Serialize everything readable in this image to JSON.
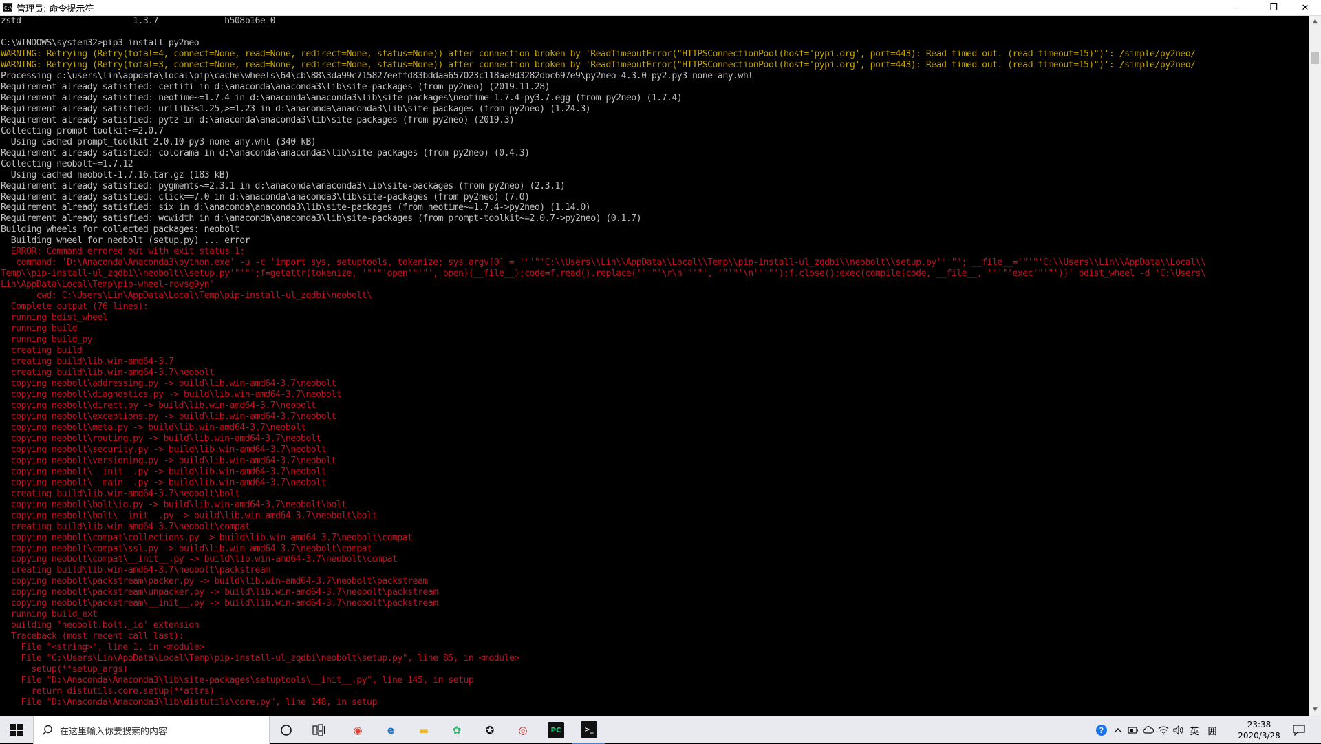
{
  "window": {
    "title": "管理员: 命令提示符",
    "controls": {
      "minimize": "—",
      "restore": "❐",
      "close": "✕"
    }
  },
  "console": {
    "lines": [
      {
        "t": "zstd                      1.3.7             h508b16e_0",
        "c": "white"
      },
      {
        "t": "",
        "c": "white"
      },
      {
        "t": "C:\\WINDOWS\\system32>pip3 install py2neo",
        "c": "white"
      },
      {
        "t": "WARNING: Retrying (Retry(total=4, connect=None, read=None, redirect=None, status=None)) after connection broken by 'ReadTimeoutError(\"HTTPSConnectionPool(host='pypi.org', port=443): Read timed out. (read timeout=15)\")': /simple/py2neo/",
        "c": "yellow"
      },
      {
        "t": "WARNING: Retrying (Retry(total=3, connect=None, read=None, redirect=None, status=None)) after connection broken by 'ReadTimeoutError(\"HTTPSConnectionPool(host='pypi.org', port=443): Read timed out. (read timeout=15)\")': /simple/py2neo/",
        "c": "yellow"
      },
      {
        "t": "Processing c:\\users\\lin\\appdata\\local\\pip\\cache\\wheels\\64\\cb\\88\\3da99c715827eeffd83bddaa657023c118aa9d3282dbc697e9\\py2neo-4.3.0-py2.py3-none-any.whl",
        "c": "white"
      },
      {
        "t": "Requirement already satisfied: certifi in d:\\anaconda\\anaconda3\\lib\\site-packages (from py2neo) (2019.11.28)",
        "c": "white"
      },
      {
        "t": "Requirement already satisfied: neotime~=1.7.4 in d:\\anaconda\\anaconda3\\lib\\site-packages\\neotime-1.7.4-py3.7.egg (from py2neo) (1.7.4)",
        "c": "white"
      },
      {
        "t": "Requirement already satisfied: urllib3<1.25,>=1.23 in d:\\anaconda\\anaconda3\\lib\\site-packages (from py2neo) (1.24.3)",
        "c": "white"
      },
      {
        "t": "Requirement already satisfied: pytz in d:\\anaconda\\anaconda3\\lib\\site-packages (from py2neo) (2019.3)",
        "c": "white"
      },
      {
        "t": "Collecting prompt-toolkit~=2.0.7",
        "c": "white"
      },
      {
        "t": "  Using cached prompt_toolkit-2.0.10-py3-none-any.whl (340 kB)",
        "c": "white"
      },
      {
        "t": "Requirement already satisfied: colorama in d:\\anaconda\\anaconda3\\lib\\site-packages (from py2neo) (0.4.3)",
        "c": "white"
      },
      {
        "t": "Collecting neobolt~=1.7.12",
        "c": "white"
      },
      {
        "t": "  Using cached neobolt-1.7.16.tar.gz (183 kB)",
        "c": "white"
      },
      {
        "t": "Requirement already satisfied: pygments~=2.3.1 in d:\\anaconda\\anaconda3\\lib\\site-packages (from py2neo) (2.3.1)",
        "c": "white"
      },
      {
        "t": "Requirement already satisfied: click==7.0 in d:\\anaconda\\anaconda3\\lib\\site-packages (from py2neo) (7.0)",
        "c": "white"
      },
      {
        "t": "Requirement already satisfied: six in d:\\anaconda\\anaconda3\\lib\\site-packages (from neotime~=1.7.4->py2neo) (1.14.0)",
        "c": "white"
      },
      {
        "t": "Requirement already satisfied: wcwidth in d:\\anaconda\\anaconda3\\lib\\site-packages (from prompt-toolkit~=2.0.7->py2neo) (0.1.7)",
        "c": "white"
      },
      {
        "t": "Building wheels for collected packages: neobolt",
        "c": "white"
      },
      {
        "t": "  Building wheel for neobolt (setup.py) ... error",
        "c": "white"
      },
      {
        "t": "  ERROR: Command errored out with exit status 1:",
        "c": "red"
      },
      {
        "t": "   command: 'D:\\Anaconda\\Anaconda3\\python.exe' -u -c 'import sys, setuptools, tokenize; sys.argv[0] = '\"'\"'C:\\\\Users\\\\Lin\\\\AppData\\\\Local\\\\Temp\\\\pip-install-ul_zqdbi\\\\neobolt\\\\setup.py'\"'\"'; __file__='\"'\"'C:\\\\Users\\\\Lin\\\\AppData\\\\Local\\\\",
        "c": "red"
      },
      {
        "t": "Temp\\\\pip-install-ul_zqdbi\\\\neobolt\\\\setup.py'\"'\"';f=getattr(tokenize, '\"'\"'open'\"'\"', open)(__file__);code=f.read().replace('\"'\"'\\r\\n'\"'\"', '\"'\"'\\n'\"'\"');f.close();exec(compile(code, __file__, '\"'\"'exec'\"'\"'))' bdist_wheel -d 'C:\\Users\\",
        "c": "red"
      },
      {
        "t": "Lin\\AppData\\Local\\Temp\\pip-wheel-rovsg9yn'",
        "c": "red"
      },
      {
        "t": "       cwd: C:\\Users\\Lin\\AppData\\Local\\Temp\\pip-install-ul_zqdbi\\neobolt\\",
        "c": "red"
      },
      {
        "t": "  Complete output (76 lines):",
        "c": "red"
      },
      {
        "t": "  running bdist_wheel",
        "c": "red"
      },
      {
        "t": "  running build",
        "c": "red"
      },
      {
        "t": "  running build_py",
        "c": "red"
      },
      {
        "t": "  creating build",
        "c": "red"
      },
      {
        "t": "  creating build\\lib.win-amd64-3.7",
        "c": "red"
      },
      {
        "t": "  creating build\\lib.win-amd64-3.7\\neobolt",
        "c": "red"
      },
      {
        "t": "  copying neobolt\\addressing.py -> build\\lib.win-amd64-3.7\\neobolt",
        "c": "red"
      },
      {
        "t": "  copying neobolt\\diagnostics.py -> build\\lib.win-amd64-3.7\\neobolt",
        "c": "red"
      },
      {
        "t": "  copying neobolt\\direct.py -> build\\lib.win-amd64-3.7\\neobolt",
        "c": "red"
      },
      {
        "t": "  copying neobolt\\exceptions.py -> build\\lib.win-amd64-3.7\\neobolt",
        "c": "red"
      },
      {
        "t": "  copying neobolt\\meta.py -> build\\lib.win-amd64-3.7\\neobolt",
        "c": "red"
      },
      {
        "t": "  copying neobolt\\routing.py -> build\\lib.win-amd64-3.7\\neobolt",
        "c": "red"
      },
      {
        "t": "  copying neobolt\\security.py -> build\\lib.win-amd64-3.7\\neobolt",
        "c": "red"
      },
      {
        "t": "  copying neobolt\\versioning.py -> build\\lib.win-amd64-3.7\\neobolt",
        "c": "red"
      },
      {
        "t": "  copying neobolt\\__init__.py -> build\\lib.win-amd64-3.7\\neobolt",
        "c": "red"
      },
      {
        "t": "  copying neobolt\\__main__.py -> build\\lib.win-amd64-3.7\\neobolt",
        "c": "red"
      },
      {
        "t": "  creating build\\lib.win-amd64-3.7\\neobolt\\bolt",
        "c": "red"
      },
      {
        "t": "  copying neobolt\\bolt\\io.py -> build\\lib.win-amd64-3.7\\neobolt\\bolt",
        "c": "red"
      },
      {
        "t": "  copying neobolt\\bolt\\__init__.py -> build\\lib.win-amd64-3.7\\neobolt\\bolt",
        "c": "red"
      },
      {
        "t": "  creating build\\lib.win-amd64-3.7\\neobolt\\compat",
        "c": "red"
      },
      {
        "t": "  copying neobolt\\compat\\collections.py -> build\\lib.win-amd64-3.7\\neobolt\\compat",
        "c": "red"
      },
      {
        "t": "  copying neobolt\\compat\\ssl.py -> build\\lib.win-amd64-3.7\\neobolt\\compat",
        "c": "red"
      },
      {
        "t": "  copying neobolt\\compat\\__init__.py -> build\\lib.win-amd64-3.7\\neobolt\\compat",
        "c": "red"
      },
      {
        "t": "  creating build\\lib.win-amd64-3.7\\neobolt\\packstream",
        "c": "red"
      },
      {
        "t": "  copying neobolt\\packstream\\packer.py -> build\\lib.win-amd64-3.7\\neobolt\\packstream",
        "c": "red"
      },
      {
        "t": "  copying neobolt\\packstream\\unpacker.py -> build\\lib.win-amd64-3.7\\neobolt\\packstream",
        "c": "red"
      },
      {
        "t": "  copying neobolt\\packstream\\__init__.py -> build\\lib.win-amd64-3.7\\neobolt\\packstream",
        "c": "red"
      },
      {
        "t": "  running build_ext",
        "c": "red"
      },
      {
        "t": "  building 'neobolt.bolt._io' extension",
        "c": "red"
      },
      {
        "t": "  Traceback (most recent call last):",
        "c": "red"
      },
      {
        "t": "    File \"<string>\", line 1, in <module>",
        "c": "red"
      },
      {
        "t": "    File \"C:\\Users\\Lin\\AppData\\Local\\Temp\\pip-install-ul_zqdbi\\neobolt\\setup.py\", line 85, in <module>",
        "c": "red"
      },
      {
        "t": "      setup(**setup_args)",
        "c": "red"
      },
      {
        "t": "    File \"D:\\Anaconda\\Anaconda3\\lib\\site-packages\\setuptools\\__init__.py\", line 145, in setup",
        "c": "red"
      },
      {
        "t": "      return distutils.core.setup(**attrs)",
        "c": "red"
      },
      {
        "t": "    File \"D:\\Anaconda\\Anaconda3\\lib\\distutils\\core.py\", line 148, in setup",
        "c": "red"
      }
    ]
  },
  "colors": {
    "white": "#c0c0c0",
    "yellow": "#c1a000",
    "red": "#c50f1f"
  },
  "taskbar": {
    "search_placeholder": "在这里输入你要搜索的内容",
    "apps": [
      {
        "name": "chrome-app",
        "glyph": "◉",
        "color": "#dd4433"
      },
      {
        "name": "edge-app",
        "glyph": "e",
        "color": "#1a73c8"
      },
      {
        "name": "file-explorer-app",
        "glyph": "▬",
        "color": "#e8b830"
      },
      {
        "name": "wechat-app",
        "glyph": "✿",
        "color": "#2aae67"
      },
      {
        "name": "qq-app",
        "glyph": "✪",
        "color": "#111111"
      },
      {
        "name": "netease-music-app",
        "glyph": "◎",
        "color": "#d81e1e"
      },
      {
        "name": "pycharm-app",
        "glyph": "PC",
        "color": "#21d789"
      },
      {
        "name": "cmd-app",
        "glyph": ">_",
        "color": "#ffffff"
      }
    ],
    "tray": {
      "ime_lang": "英",
      "ime_mode": "囲",
      "time": "23:38",
      "date": "2020/3/28"
    }
  }
}
